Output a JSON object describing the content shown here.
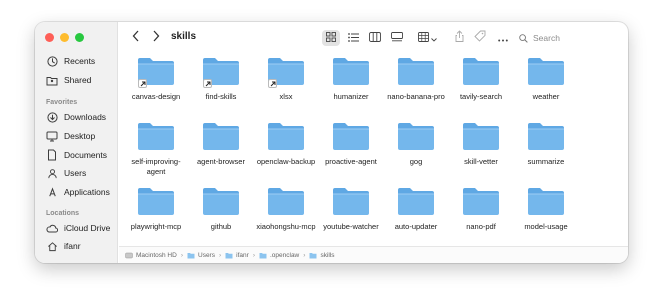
{
  "window": {
    "title": "skills"
  },
  "sidebar": {
    "favorites_heading": "Favorites",
    "locations_heading": "Locations",
    "top_items": [
      {
        "label": "Recents",
        "icon": "clock-icon"
      },
      {
        "label": "Shared",
        "icon": "shared-folder-icon"
      }
    ],
    "favorites": [
      {
        "label": "Downloads",
        "icon": "download-icon"
      },
      {
        "label": "Desktop",
        "icon": "desktop-icon"
      },
      {
        "label": "Documents",
        "icon": "document-icon"
      },
      {
        "label": "Users",
        "icon": "users-icon"
      },
      {
        "label": "Applications",
        "icon": "applications-icon"
      }
    ],
    "locations": [
      {
        "label": "iCloud Drive",
        "icon": "cloud-icon"
      },
      {
        "label": "ifanr",
        "icon": "house-icon"
      }
    ]
  },
  "toolbar": {
    "search_placeholder": "Search",
    "active_view": "icon-view"
  },
  "files": [
    {
      "name": "canvas-design",
      "alias": true
    },
    {
      "name": "find-skills",
      "alias": true
    },
    {
      "name": "xlsx",
      "alias": true
    },
    {
      "name": "humanizer",
      "alias": false
    },
    {
      "name": "nano-banana-pro",
      "alias": false
    },
    {
      "name": "tavily-search",
      "alias": false
    },
    {
      "name": "weather",
      "alias": false
    },
    {
      "name": "self-improving-agent",
      "alias": false
    },
    {
      "name": "agent-browser",
      "alias": false
    },
    {
      "name": "openclaw-backup",
      "alias": false
    },
    {
      "name": "proactive-agent",
      "alias": false
    },
    {
      "name": "gog",
      "alias": false
    },
    {
      "name": "skill-vetter",
      "alias": false
    },
    {
      "name": "summarize",
      "alias": false
    },
    {
      "name": "playwright-mcp",
      "alias": false
    },
    {
      "name": "github",
      "alias": false
    },
    {
      "name": "xiaohongshu-mcp",
      "alias": false
    },
    {
      "name": "youtube-watcher",
      "alias": false
    },
    {
      "name": "auto-updater",
      "alias": false
    },
    {
      "name": "nano-pdf",
      "alias": false
    },
    {
      "name": "model-usage",
      "alias": false
    }
  ],
  "pathbar": [
    "Macintosh HD",
    "Users",
    "ifanr",
    ".openclaw",
    "skills"
  ],
  "colors": {
    "folder": "#74b7ec",
    "folder_tab": "#5fa8e4",
    "accent": "#0a84ff"
  }
}
